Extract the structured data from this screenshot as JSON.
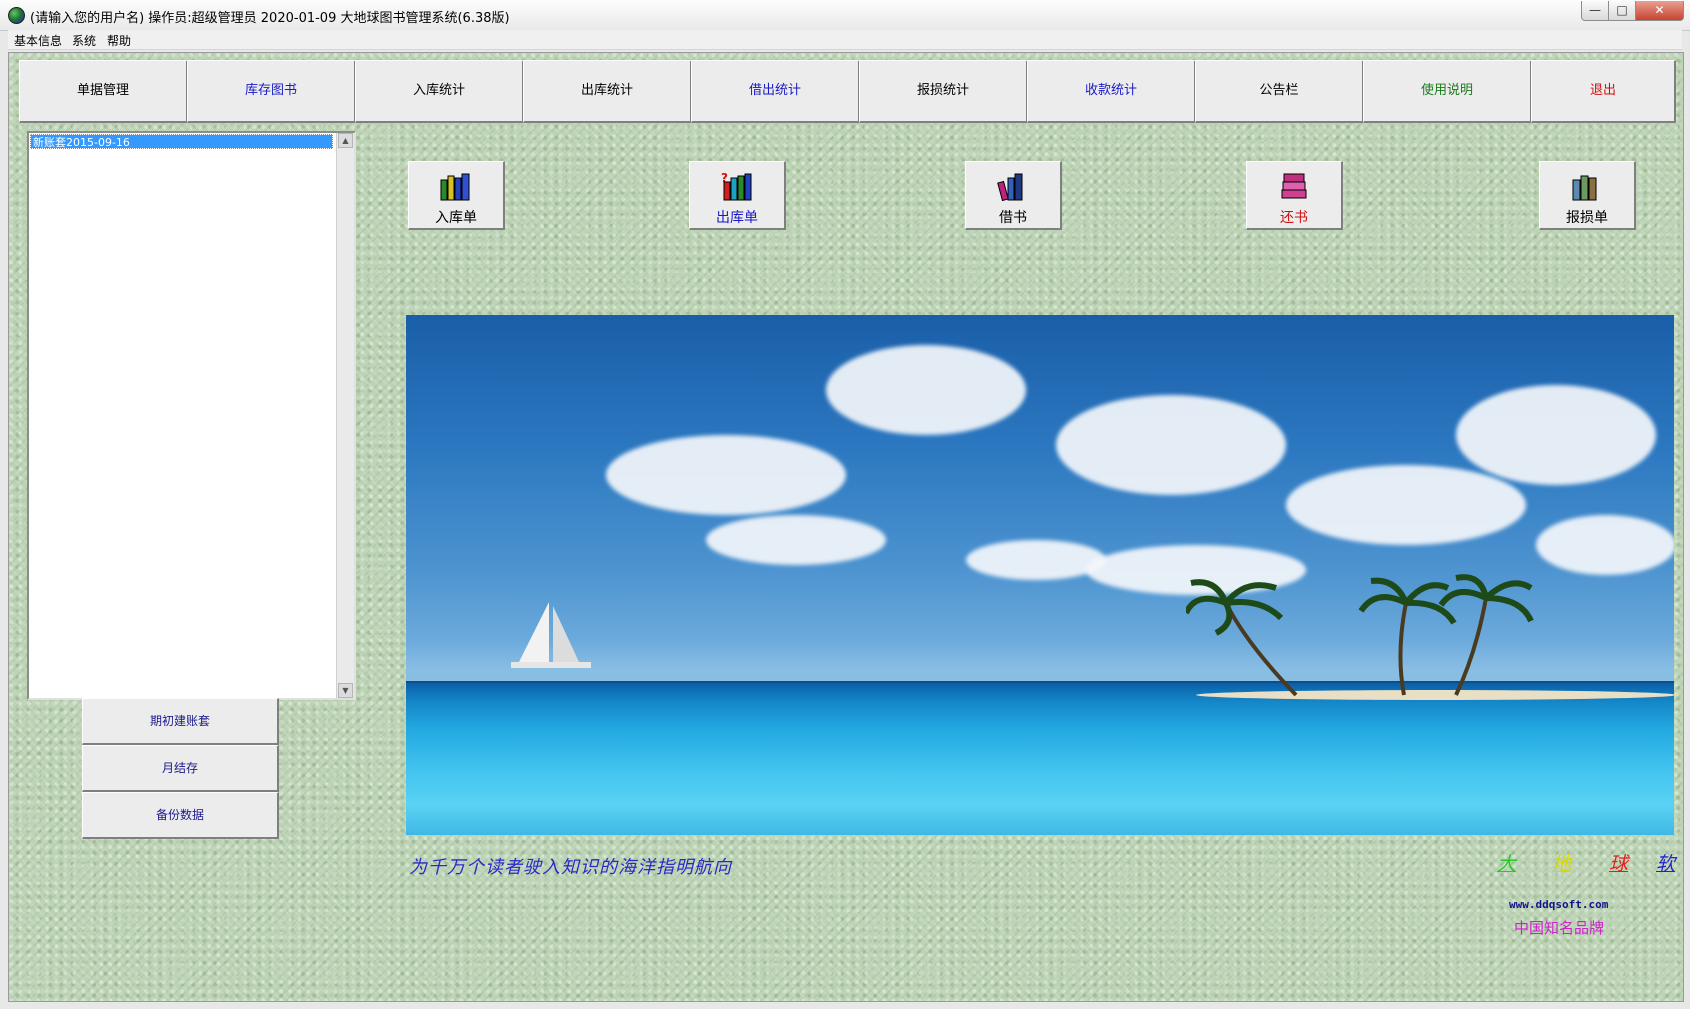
{
  "window": {
    "title": "(请输入您的用户名)   操作员:超级管理员    2020-01-09    大地球图书管理系统(6.38版)",
    "minimize": "—",
    "maximize": "□",
    "close": "✕"
  },
  "menu": [
    "基本信息",
    "系统",
    "帮助"
  ],
  "nav": [
    {
      "label": "单据管理",
      "color": "#000000"
    },
    {
      "label": "库存图书",
      "color": "#1a1ac8"
    },
    {
      "label": "入库统计",
      "color": "#000000"
    },
    {
      "label": "出库统计",
      "color": "#000000"
    },
    {
      "label": "借出统计",
      "color": "#1a1ac8"
    },
    {
      "label": "报损统计",
      "color": "#000000"
    },
    {
      "label": "收款统计",
      "color": "#1a1ac8"
    },
    {
      "label": "公告栏",
      "color": "#000000"
    },
    {
      "label": "使用说明",
      "color": "#1a7a1a"
    },
    {
      "label": "退出",
      "color": "#d01010"
    }
  ],
  "accounts": {
    "items": [
      "新账套2015-09-16"
    ]
  },
  "side_buttons": [
    "期初建账套",
    "月结存",
    "备份数据"
  ],
  "quick_buttons": [
    {
      "label": "入库单",
      "icon": "books-stock-in-icon",
      "color": "#000000"
    },
    {
      "label": "出库单",
      "icon": "books-stock-out-icon",
      "color": "#1a1ac8"
    },
    {
      "label": "借书",
      "icon": "book-borrow-icon",
      "color": "#000000"
    },
    {
      "label": "还书",
      "icon": "book-return-icon",
      "color": "#d01010"
    },
    {
      "label": "报损单",
      "icon": "book-damage-icon",
      "color": "#000000"
    }
  ],
  "slogan": "为千万个读者驶入知识的海洋指明航向",
  "brand": {
    "chars": [
      {
        "text": "大",
        "color": "#22cc22"
      },
      {
        "text": "地",
        "color": "#d8d800"
      },
      {
        "text": "球",
        "color": "#e02020"
      },
      {
        "text": "软",
        "color": "#2222d0"
      }
    ],
    "website": "www.ddqsoft.com",
    "tagline": "中国知名品牌"
  }
}
